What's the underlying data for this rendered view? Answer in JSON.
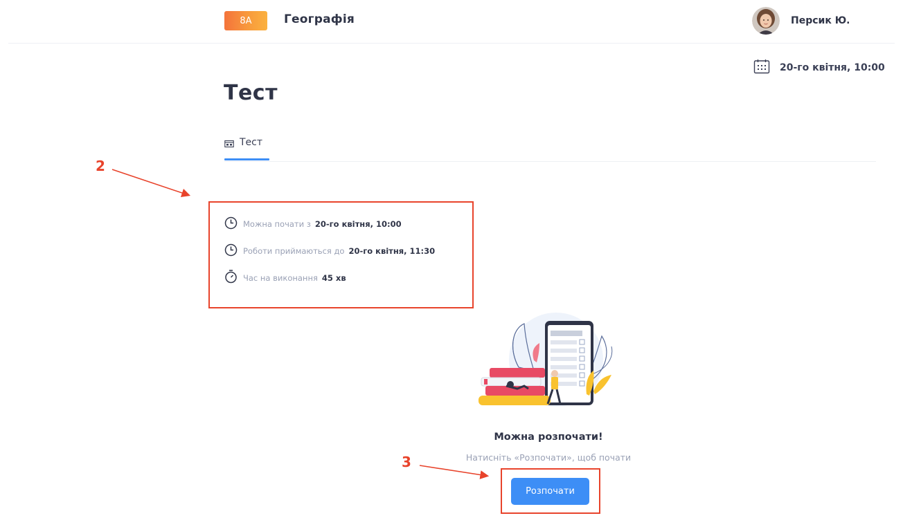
{
  "header": {
    "class_badge": "8A",
    "subject": "Географія",
    "user_name": "Персик Ю."
  },
  "date": {
    "icon": "calendar-icon",
    "text": "20-го квітня, 10:00"
  },
  "page": {
    "title": "Тест"
  },
  "tabs": [
    {
      "label": "Тест",
      "icon": "test-icon",
      "active": true
    }
  ],
  "info": [
    {
      "icon": "clock-icon",
      "label": "Можна почати з",
      "value": "20-го квітня, 10:00"
    },
    {
      "icon": "clock-icon",
      "label": "Роботи приймаються до",
      "value": "20-го квітня, 11:30"
    },
    {
      "icon": "stopwatch-icon",
      "label": "Час на виконання",
      "value": "45 хв"
    }
  ],
  "ready": {
    "title": "Можна розпочати!",
    "hint": "Натисніть «Розпочати», щоб почати",
    "button_label": "Розпочати"
  },
  "annotations": {
    "callout_2": "2",
    "callout_3": "3"
  },
  "colors": {
    "accent": "#3d8ef6",
    "badge_start": "#f4733b",
    "badge_end": "#fbb13f",
    "annotation_red": "#e8432b",
    "muted_text": "#9aa1b5"
  }
}
